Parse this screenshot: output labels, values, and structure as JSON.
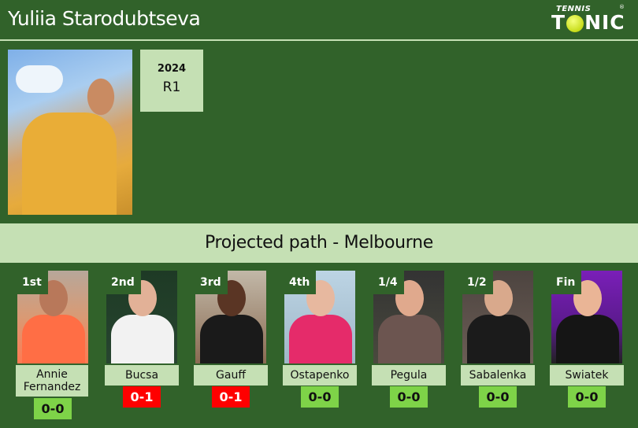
{
  "header": {
    "title": "Yuliia Starodubtseva",
    "logo_top": "TENNIS",
    "logo_main_left": "T",
    "logo_main_right": "NIC",
    "logo_reg": "®"
  },
  "player": {
    "photo_alt": "Yuliia Starodubtseva photo",
    "year": "2024",
    "round": "R1"
  },
  "banner": {
    "text": "Projected path - Melbourne"
  },
  "colors": {
    "background": "#31622a",
    "light_green": "#c5e0b4",
    "record_neutral": "#7ed348",
    "record_loss": "#ff0000"
  },
  "opponents": [
    {
      "round": "1st",
      "name": "Annie Fernandez",
      "record": "0-0",
      "status": "neutral"
    },
    {
      "round": "2nd",
      "name": "Bucsa",
      "record": "0-1",
      "status": "loss"
    },
    {
      "round": "3rd",
      "name": "Gauff",
      "record": "0-1",
      "status": "loss"
    },
    {
      "round": "4th",
      "name": "Ostapenko",
      "record": "0-0",
      "status": "neutral"
    },
    {
      "round": "1/4",
      "name": "Pegula",
      "record": "0-0",
      "status": "neutral"
    },
    {
      "round": "1/2",
      "name": "Sabalenka",
      "record": "0-0",
      "status": "neutral"
    },
    {
      "round": "Fin",
      "name": "Swiatek",
      "record": "0-0",
      "status": "neutral"
    }
  ]
}
